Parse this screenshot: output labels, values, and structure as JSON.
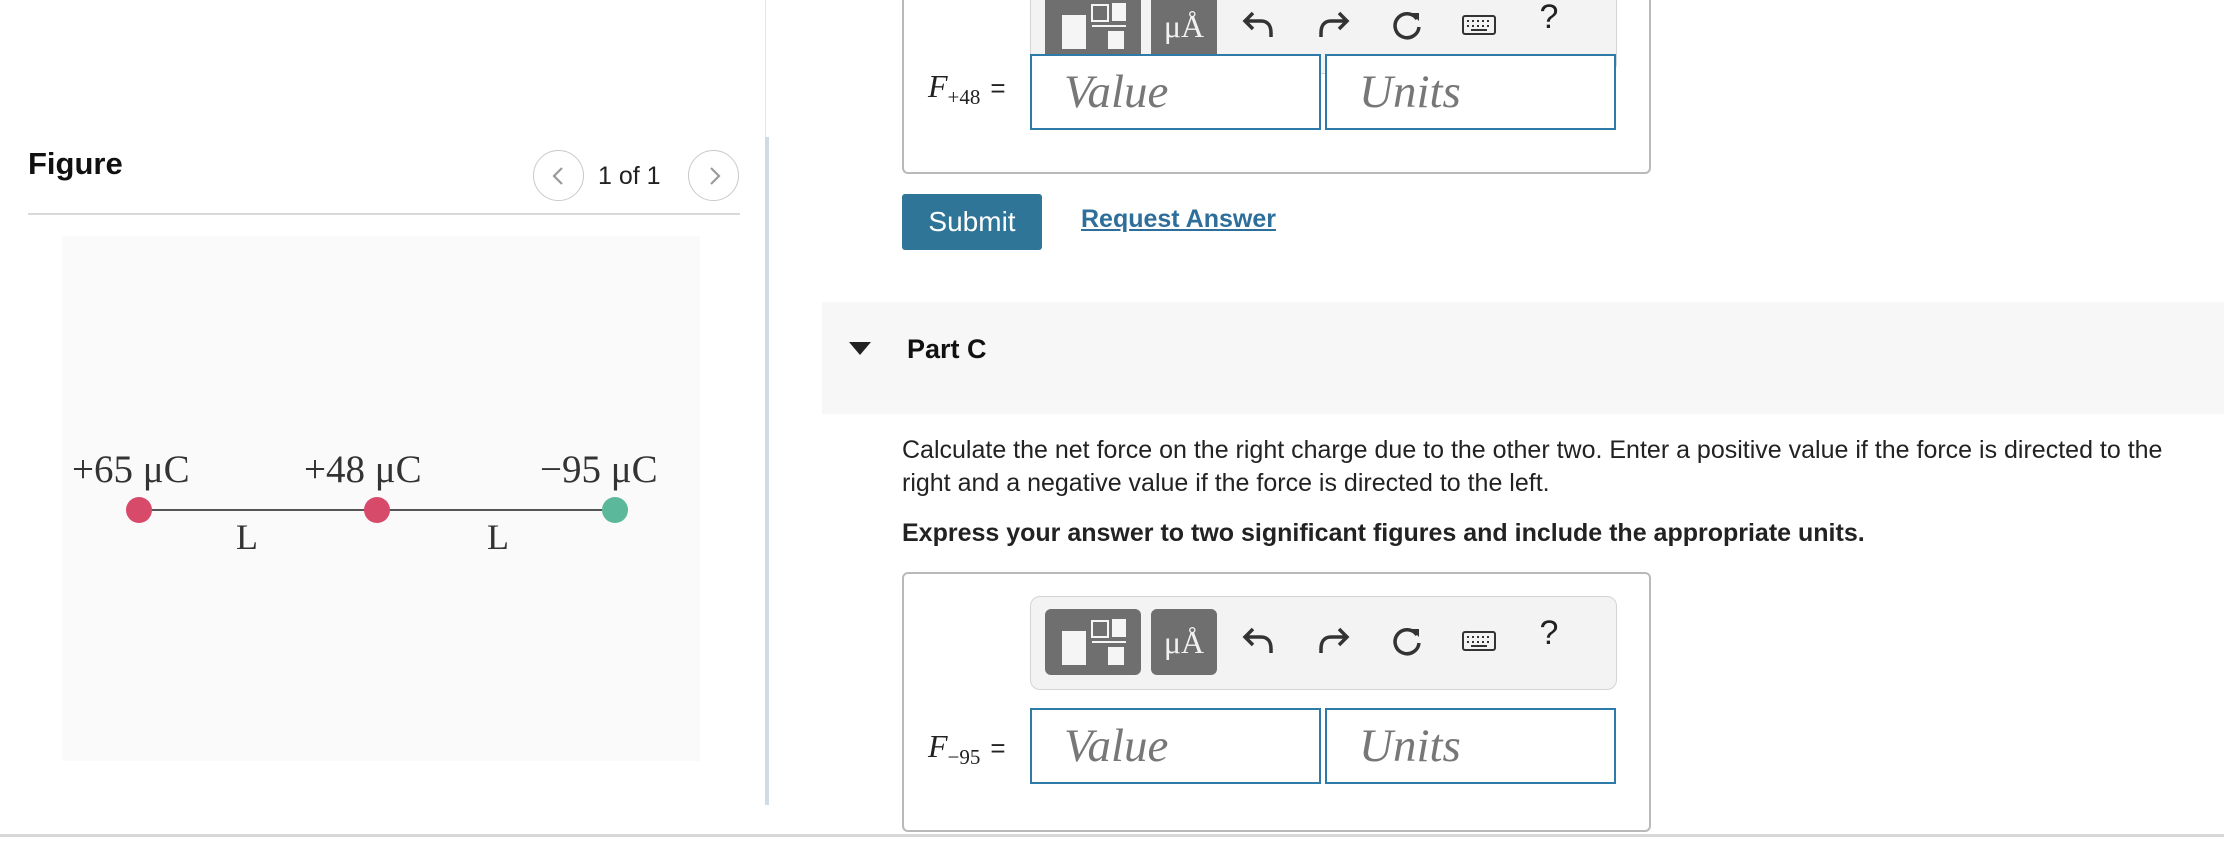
{
  "figure": {
    "title": "Figure",
    "pager": "1 of 1",
    "charges": [
      {
        "label": "+65 μC",
        "color": "#d84a6a"
      },
      {
        "label": "+48 μC",
        "color": "#d84a6a"
      },
      {
        "label": "−95 μC",
        "color": "#5cb89a"
      }
    ],
    "distances": [
      "L",
      "L"
    ]
  },
  "part_b": {
    "toolbar": {
      "units_label": "μÅ",
      "help_label": "?"
    },
    "answer_label": {
      "variable": "F",
      "subscript": "+48",
      "equals": "="
    },
    "value_placeholder": "Value",
    "units_placeholder": "Units",
    "submit_label": "Submit",
    "request_label": "Request Answer"
  },
  "part_c": {
    "title": "Part C",
    "prompt": "Calculate the net force on the right charge due to the other two. Enter a positive value if the force is directed to the right and a negative value if the force is directed to the left.",
    "instruction": "Express your answer to two significant figures and include the appropriate units.",
    "toolbar": {
      "units_label": "μÅ",
      "help_label": "?"
    },
    "answer_label": {
      "variable": "F",
      "subscript": "−95",
      "equals": "="
    },
    "value_placeholder": "Value",
    "units_placeholder": "Units"
  },
  "colors": {
    "accent": "#2e7598",
    "field_border": "#2e7aa8",
    "link": "#2e6e9a"
  }
}
